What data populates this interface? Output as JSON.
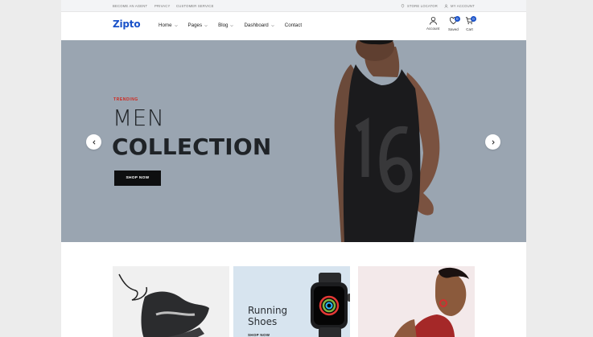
{
  "topbar": {
    "left_links": [
      "BECOME AN AGENT",
      "PRIVACY",
      "CUSTOMER SERVICE"
    ],
    "store_locator": "STORE LOCATOR",
    "my_account": "MY ACCOUNT"
  },
  "header": {
    "logo": "Zipto",
    "nav": [
      {
        "label": "Home",
        "dropdown": true
      },
      {
        "label": "Pages",
        "dropdown": true
      },
      {
        "label": "Blog",
        "dropdown": true
      },
      {
        "label": "Dashboard",
        "dropdown": true
      },
      {
        "label": "Contact",
        "dropdown": false
      }
    ],
    "account_label": "Account",
    "saved_label": "Saved",
    "saved_count": "0",
    "cart_label": "Cart",
    "cart_count": "0"
  },
  "hero": {
    "eyebrow": "TRENDING",
    "title_light": "MEN",
    "title_bold": "COLLECTION",
    "button": "SHOP NOW"
  },
  "cards": [
    {
      "name": "sneaker-card"
    },
    {
      "name": "running-shoes-card",
      "title_line1": "Running",
      "title_line2": "Shoes",
      "link": "SHOP NOW"
    },
    {
      "name": "woman-card"
    }
  ],
  "colors": {
    "brand": "#1a52c9",
    "accent_red": "#d0271d",
    "hero_bg": "#9aa5b1",
    "button_dark": "#0e0f10"
  }
}
